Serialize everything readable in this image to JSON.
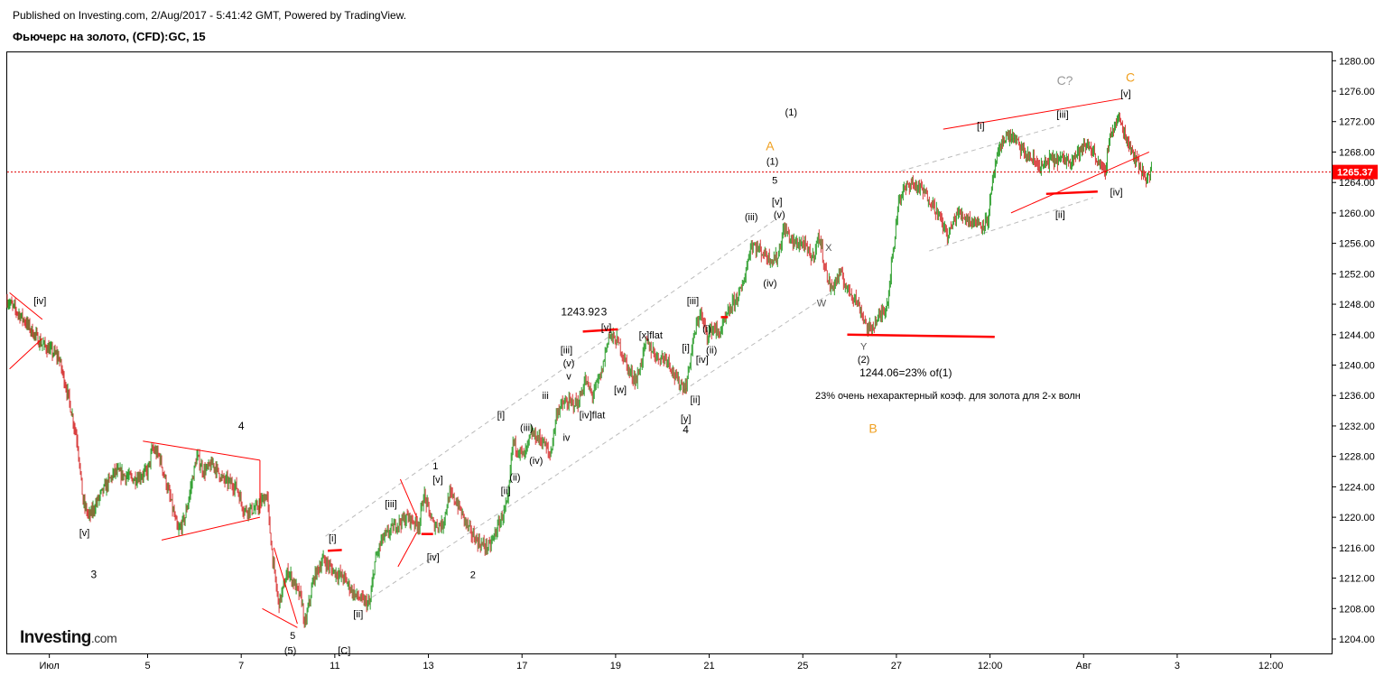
{
  "header": {
    "published": "Published on Investing.com, 2/Aug/2017 - 5:41:42 GMT, Powered by TradingView.",
    "title": "Фьючерс на золото, (CFD):GC, 15"
  },
  "logo": {
    "main": "Investing",
    "suffix": ".com"
  },
  "colors": {
    "up": "#2a9d2a",
    "down": "#d83a3a",
    "trend": "#ff0000",
    "channel": "#bbbbbb",
    "price_tag": "#ff0000",
    "orange": "#f0a020",
    "grey_label": "#999999"
  },
  "chart_data": {
    "type": "candlestick",
    "ylim": [
      1202,
      1282
    ],
    "y_ticks": [
      "1280.00",
      "1276.00",
      "1272.00",
      "1268.00",
      "1264.00",
      "1260.00",
      "1256.00",
      "1252.00",
      "1248.00",
      "1244.00",
      "1240.00",
      "1236.00",
      "1232.00",
      "1228.00",
      "1224.00",
      "1220.00",
      "1216.00",
      "1212.00",
      "1208.00",
      "1204.00"
    ],
    "x_ticks": [
      {
        "label": "Июл",
        "t": 0.9
      },
      {
        "label": "5",
        "t": 3
      },
      {
        "label": "7",
        "t": 5
      },
      {
        "label": "11",
        "t": 7
      },
      {
        "label": "13",
        "t": 9
      },
      {
        "label": "17",
        "t": 11
      },
      {
        "label": "19",
        "t": 13
      },
      {
        "label": "21",
        "t": 15
      },
      {
        "label": "25",
        "t": 17
      },
      {
        "label": "27",
        "t": 19
      },
      {
        "label": "12:00",
        "t": 21
      },
      {
        "label": "Авг",
        "t": 23
      },
      {
        "label": "3",
        "t": 25
      },
      {
        "label": "12:00",
        "t": 27
      }
    ],
    "last_price": 1265.37,
    "price_path": [
      [
        0.0,
        1248.5
      ],
      [
        0.35,
        1246
      ],
      [
        0.7,
        1243
      ],
      [
        1.1,
        1241
      ],
      [
        1.3,
        1236
      ],
      [
        1.5,
        1230
      ],
      [
        1.62,
        1222
      ],
      [
        1.75,
        1220
      ],
      [
        2.0,
        1223
      ],
      [
        2.3,
        1226
      ],
      [
        2.7,
        1225
      ],
      [
        3.0,
        1226
      ],
      [
        3.1,
        1229
      ],
      [
        3.25,
        1228
      ],
      [
        3.5,
        1222
      ],
      [
        3.65,
        1218
      ],
      [
        3.8,
        1220
      ],
      [
        4.05,
        1228
      ],
      [
        4.2,
        1226
      ],
      [
        4.4,
        1227
      ],
      [
        4.6,
        1225
      ],
      [
        4.9,
        1224
      ],
      [
        5.05,
        1221
      ],
      [
        5.3,
        1221
      ],
      [
        5.55,
        1223
      ],
      [
        5.6,
        1219
      ],
      [
        5.7,
        1213
      ],
      [
        5.8,
        1208.5
      ],
      [
        6.0,
        1213
      ],
      [
        6.15,
        1211
      ],
      [
        6.3,
        1209
      ],
      [
        6.35,
        1205.5
      ],
      [
        6.55,
        1212
      ],
      [
        6.75,
        1214.5
      ],
      [
        6.95,
        1213
      ],
      [
        7.2,
        1212
      ],
      [
        7.4,
        1210
      ],
      [
        7.6,
        1209
      ],
      [
        7.75,
        1208.5
      ],
      [
        7.85,
        1214
      ],
      [
        8.0,
        1217
      ],
      [
        8.3,
        1219
      ],
      [
        8.55,
        1220
      ],
      [
        8.8,
        1219
      ],
      [
        8.9,
        1223
      ],
      [
        9.1,
        1219
      ],
      [
        9.3,
        1219
      ],
      [
        9.45,
        1223
      ],
      [
        9.6,
        1222
      ],
      [
        9.9,
        1218
      ],
      [
        10.1,
        1216.5
      ],
      [
        10.3,
        1216
      ],
      [
        10.5,
        1219
      ],
      [
        10.7,
        1222
      ],
      [
        10.8,
        1230
      ],
      [
        10.9,
        1229
      ],
      [
        11.05,
        1228
      ],
      [
        11.2,
        1231
      ],
      [
        11.45,
        1230
      ],
      [
        11.6,
        1228
      ],
      [
        11.75,
        1234
      ],
      [
        11.9,
        1235
      ],
      [
        12.2,
        1235
      ],
      [
        12.35,
        1238
      ],
      [
        12.5,
        1236
      ],
      [
        12.7,
        1239
      ],
      [
        12.85,
        1244
      ],
      [
        13.05,
        1243
      ],
      [
        13.3,
        1239
      ],
      [
        13.45,
        1238
      ],
      [
        13.65,
        1243
      ],
      [
        13.9,
        1241
      ],
      [
        14.1,
        1241
      ],
      [
        14.3,
        1238
      ],
      [
        14.5,
        1237
      ],
      [
        14.65,
        1243
      ],
      [
        14.8,
        1247
      ],
      [
        14.95,
        1244
      ],
      [
        15.1,
        1245
      ],
      [
        15.2,
        1244
      ],
      [
        15.5,
        1248
      ],
      [
        15.7,
        1250
      ],
      [
        15.9,
        1256
      ],
      [
        16.1,
        1255
      ],
      [
        16.3,
        1254
      ],
      [
        16.45,
        1254
      ],
      [
        16.6,
        1258
      ],
      [
        16.8,
        1256
      ],
      [
        17.0,
        1256
      ],
      [
        17.2,
        1254
      ],
      [
        17.35,
        1257
      ],
      [
        17.5,
        1252
      ],
      [
        17.6,
        1250
      ],
      [
        17.8,
        1252
      ],
      [
        17.95,
        1250
      ],
      [
        18.1,
        1249
      ],
      [
        18.25,
        1247
      ],
      [
        18.4,
        1244.5
      ],
      [
        18.6,
        1246
      ],
      [
        18.8,
        1248
      ],
      [
        18.95,
        1256
      ],
      [
        19.05,
        1262
      ],
      [
        19.3,
        1264
      ],
      [
        19.55,
        1263
      ],
      [
        19.8,
        1261
      ],
      [
        19.95,
        1259
      ],
      [
        20.1,
        1257
      ],
      [
        20.3,
        1260
      ],
      [
        20.6,
        1259
      ],
      [
        20.8,
        1258.5
      ],
      [
        20.95,
        1259
      ],
      [
        21.1,
        1266
      ],
      [
        21.3,
        1270
      ],
      [
        21.5,
        1270
      ],
      [
        21.7,
        1268
      ],
      [
        21.9,
        1267
      ],
      [
        22.1,
        1266
      ],
      [
        22.3,
        1267
      ],
      [
        22.5,
        1267
      ],
      [
        22.7,
        1267
      ],
      [
        22.9,
        1268
      ],
      [
        23.1,
        1269
      ],
      [
        23.3,
        1267
      ],
      [
        23.45,
        1265
      ],
      [
        23.55,
        1270
      ],
      [
        23.75,
        1272.5
      ],
      [
        23.9,
        1270
      ],
      [
        24.05,
        1268
      ],
      [
        24.2,
        1266
      ],
      [
        24.35,
        1264.5
      ],
      [
        24.45,
        1265.37
      ]
    ]
  },
  "annotations": [
    {
      "text": "[iv]",
      "t": 0.7,
      "p": 1248.5,
      "c": "#000"
    },
    {
      "text": "[v]",
      "t": 1.65,
      "p": 1218,
      "c": "#000"
    },
    {
      "text": "3",
      "t": 1.85,
      "p": 1212.5,
      "c": "#000",
      "s": 12
    },
    {
      "text": "4",
      "t": 5.0,
      "p": 1232,
      "c": "#000",
      "s": 12
    },
    {
      "text": "5",
      "t": 6.1,
      "p": 1204.5,
      "c": "#000"
    },
    {
      "text": "(5)",
      "t": 6.05,
      "p": 1202.5,
      "c": "#000"
    },
    {
      "text": "[C]",
      "t": 7.2,
      "p": 1202.5,
      "c": "#000"
    },
    {
      "text": "[i]",
      "t": 6.95,
      "p": 1217.3,
      "c": "#000"
    },
    {
      "text": "[ii]",
      "t": 7.5,
      "p": 1207.3,
      "c": "#000"
    },
    {
      "text": "[iii]",
      "t": 8.2,
      "p": 1221.8,
      "c": "#000"
    },
    {
      "text": "[iv]",
      "t": 9.1,
      "p": 1214.8,
      "c": "#000"
    },
    {
      "text": "1",
      "t": 9.15,
      "p": 1226.8,
      "c": "#000"
    },
    {
      "text": "[v]",
      "t": 9.2,
      "p": 1225,
      "c": "#000"
    },
    {
      "text": "2",
      "t": 9.95,
      "p": 1212.5,
      "c": "#000"
    },
    {
      "text": "[i]",
      "t": 10.55,
      "p": 1233.5,
      "c": "#000"
    },
    {
      "text": "[ii]",
      "t": 10.65,
      "p": 1223.5,
      "c": "#000"
    },
    {
      "text": "(iii)",
      "t": 11.1,
      "p": 1231.8,
      "c": "#000"
    },
    {
      "text": "(ii)",
      "t": 10.85,
      "p": 1225.3,
      "c": "#000"
    },
    {
      "text": "(iv)",
      "t": 11.3,
      "p": 1227.5,
      "c": "#000"
    },
    {
      "text": "iii",
      "t": 11.5,
      "p": 1236,
      "c": "#000"
    },
    {
      "text": "iv",
      "t": 11.95,
      "p": 1230.5,
      "c": "#000"
    },
    {
      "text": "[iii]",
      "t": 11.95,
      "p": 1242,
      "c": "#000"
    },
    {
      "text": "(v)",
      "t": 12.0,
      "p": 1240.3,
      "c": "#000"
    },
    {
      "text": "v",
      "t": 12.0,
      "p": 1238.6,
      "c": "#000"
    },
    {
      "text": "[iv]flat",
      "t": 12.5,
      "p": 1233.5,
      "c": "#000"
    },
    {
      "text": "1243.92",
      "t": 12.25,
      "p": 1247,
      "c": "#000",
      "s": 12
    },
    {
      "text": "3",
      "t": 12.75,
      "p": 1247,
      "c": "#000",
      "s": 12
    },
    {
      "text": "[v]",
      "t": 12.8,
      "p": 1245,
      "c": "#000"
    },
    {
      "text": "[x]flat",
      "t": 13.75,
      "p": 1244,
      "c": "#000"
    },
    {
      "text": "[w]",
      "t": 13.1,
      "p": 1236.8,
      "c": "#000"
    },
    {
      "text": "[i]",
      "t": 14.5,
      "p": 1242.3,
      "c": "#000"
    },
    {
      "text": "[iii]",
      "t": 14.65,
      "p": 1248.5,
      "c": "#000"
    },
    {
      "text": "(i)",
      "t": 14.95,
      "p": 1244.8,
      "c": "#000"
    },
    {
      "text": "(ii)",
      "t": 15.05,
      "p": 1242,
      "c": "#000"
    },
    {
      "text": "[iv]",
      "t": 14.85,
      "p": 1240.8,
      "c": "#000"
    },
    {
      "text": "[ii]",
      "t": 14.7,
      "p": 1235.5,
      "c": "#000"
    },
    {
      "text": "[y]",
      "t": 14.5,
      "p": 1233,
      "c": "#000"
    },
    {
      "text": "4",
      "t": 14.5,
      "p": 1231.5,
      "c": "#000",
      "s": 12
    },
    {
      "text": "(iii)",
      "t": 15.9,
      "p": 1259.5,
      "c": "#000"
    },
    {
      "text": "(iv)",
      "t": 16.3,
      "p": 1250.8,
      "c": "#000"
    },
    {
      "text": "(v)",
      "t": 16.5,
      "p": 1259.8,
      "c": "#000"
    },
    {
      "text": "[v]",
      "t": 16.45,
      "p": 1261.5,
      "c": "#000"
    },
    {
      "text": "5",
      "t": 16.4,
      "p": 1264.3,
      "c": "#000"
    },
    {
      "text": "(1)",
      "t": 16.35,
      "p": 1266.8,
      "c": "#000"
    },
    {
      "text": "A",
      "t": 16.3,
      "p": 1268.7,
      "c": "#f0a020",
      "s": 14
    },
    {
      "text": "(1)",
      "t": 16.75,
      "p": 1273.3,
      "c": "#000"
    },
    {
      "text": "X",
      "t": 17.55,
      "p": 1255.5,
      "c": "#555"
    },
    {
      "text": "W",
      "t": 17.4,
      "p": 1248.2,
      "c": "#555"
    },
    {
      "text": "Y",
      "t": 18.3,
      "p": 1242.5,
      "c": "#555"
    },
    {
      "text": "(2)",
      "t": 18.3,
      "p": 1240.8,
      "c": "#000"
    },
    {
      "text": "1244.06=23% of(1)",
      "t": 19.2,
      "p": 1239,
      "c": "#000",
      "s": 12
    },
    {
      "text": "23% очень нехарактерный коэф. для золота для 2-х волн",
      "t": 20.1,
      "p": 1236,
      "c": "#000",
      "s": 11
    },
    {
      "text": "B",
      "t": 18.5,
      "p": 1231.6,
      "c": "#f0a020",
      "s": 14
    },
    {
      "text": "[i]",
      "t": 20.8,
      "p": 1271.5,
      "c": "#000"
    },
    {
      "text": "[ii]",
      "t": 22.5,
      "p": 1259.8,
      "c": "#000"
    },
    {
      "text": "[iii]",
      "t": 22.55,
      "p": 1273,
      "c": "#000"
    },
    {
      "text": "C?",
      "t": 22.6,
      "p": 1277.3,
      "c": "#999999",
      "s": 14
    },
    {
      "text": "C",
      "t": 24.0,
      "p": 1277.7,
      "c": "#f0a020",
      "s": 14
    },
    {
      "text": "[v]",
      "t": 23.9,
      "p": 1275.7,
      "c": "#000"
    },
    {
      "text": "[iv]",
      "t": 23.7,
      "p": 1262.8,
      "c": "#000"
    }
  ]
}
